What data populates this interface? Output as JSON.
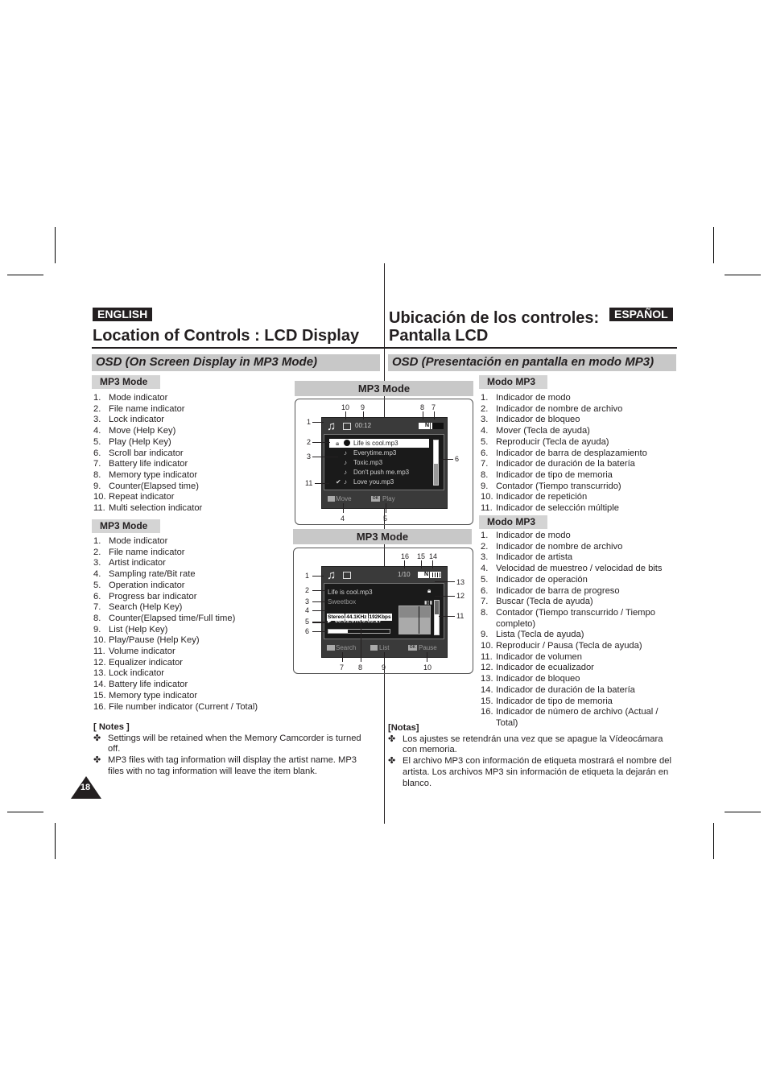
{
  "english": {
    "badge": "ENGLISH",
    "title": "Location of Controls : LCD Display",
    "section": "OSD (On Screen Display in MP3 Mode)",
    "list1": {
      "heading": "MP3 Mode",
      "items": [
        {
          "n": "1.",
          "t": "Mode indicator"
        },
        {
          "n": "2.",
          "t": "File name indicator"
        },
        {
          "n": "3.",
          "t": "Lock indicator"
        },
        {
          "n": "4.",
          "t": "Move (Help Key)"
        },
        {
          "n": "5.",
          "t": "Play (Help Key)"
        },
        {
          "n": "6.",
          "t": "Scroll bar indicator"
        },
        {
          "n": "7.",
          "t": "Battery life indicator"
        },
        {
          "n": "8.",
          "t": "Memory type indicator"
        },
        {
          "n": "9.",
          "t": "Counter(Elapsed time)"
        },
        {
          "n": "10.",
          "t": "Repeat indicator"
        },
        {
          "n": "11.",
          "t": "Multi selection indicator"
        }
      ]
    },
    "list2": {
      "heading": "MP3 Mode",
      "items": [
        {
          "n": "1.",
          "t": "Mode indicator"
        },
        {
          "n": "2.",
          "t": "File name indicator"
        },
        {
          "n": "3.",
          "t": "Artist indicator"
        },
        {
          "n": "4.",
          "t": "Sampling rate/Bit rate"
        },
        {
          "n": "5.",
          "t": "Operation indicator"
        },
        {
          "n": "6.",
          "t": "Progress bar indicator"
        },
        {
          "n": "7.",
          "t": "Search (Help Key)"
        },
        {
          "n": "8.",
          "t": "Counter(Elapsed time/Full time)"
        },
        {
          "n": "9.",
          "t": "List (Help Key)"
        },
        {
          "n": "10.",
          "t": "Play/Pause (Help Key)"
        },
        {
          "n": "11.",
          "t": "Volume indicator"
        },
        {
          "n": "12.",
          "t": "Equalizer indicator"
        },
        {
          "n": "13.",
          "t": "Lock indicator"
        },
        {
          "n": "14.",
          "t": "Battery life indicator"
        },
        {
          "n": "15.",
          "t": "Memory type indicator"
        },
        {
          "n": "16.",
          "t": "File number indicator (Current / Total)"
        }
      ]
    },
    "notes": {
      "heading": "[ Notes ]",
      "items": [
        "Settings will be retained when the Memory Camcorder is turned off.",
        "MP3 files with tag information will display the artist name. MP3 files with no tag information will leave the item blank."
      ]
    },
    "page_number": "18"
  },
  "espanol": {
    "badge": "ESPAÑOL",
    "title_line1": "Ubicación de los controles:",
    "title_line2": "Pantalla LCD",
    "section": "OSD (Presentación en pantalla en modo MP3)",
    "list1": {
      "heading": "Modo MP3",
      "items": [
        {
          "n": "1.",
          "t": "Indicador de modo"
        },
        {
          "n": "2.",
          "t": "Indicador de nombre de archivo"
        },
        {
          "n": "3.",
          "t": "Indicador de bloqueo"
        },
        {
          "n": "4.",
          "t": "Mover (Tecla de ayuda)"
        },
        {
          "n": "5.",
          "t": "Reproducir (Tecla de ayuda)"
        },
        {
          "n": "6.",
          "t": "Indicador de barra de desplazamiento"
        },
        {
          "n": "7.",
          "t": "Indicador de duración de la batería"
        },
        {
          "n": "8.",
          "t": "Indicador de tipo de memoria"
        },
        {
          "n": "9.",
          "t": "Contador (Tiempo transcurrido)"
        },
        {
          "n": "10.",
          "t": "Indicador de repetición"
        },
        {
          "n": "11.",
          "t": "Indicador de selección múltiple"
        }
      ]
    },
    "list2": {
      "heading": "Modo MP3",
      "items": [
        {
          "n": "1.",
          "t": "Indicador de modo"
        },
        {
          "n": "2.",
          "t": "Indicador de nombre de archivo"
        },
        {
          "n": "3.",
          "t": "Indicador de artista"
        },
        {
          "n": "4.",
          "t": "Velocidad de muestreo / velocidad de bits"
        },
        {
          "n": "5.",
          "t": "Indicador de operación"
        },
        {
          "n": "6.",
          "t": "Indicador de barra de progreso"
        },
        {
          "n": "7.",
          "t": "Buscar (Tecla de ayuda)"
        },
        {
          "n": "8.",
          "t": "Contador (Tiempo transcurrido / Tiempo completo)"
        },
        {
          "n": "9.",
          "t": "Lista (Tecla de ayuda)"
        },
        {
          "n": "10.",
          "t": "Reproducir / Pausa (Tecla de ayuda)"
        },
        {
          "n": "11.",
          "t": "Indicador de volumen"
        },
        {
          "n": "12.",
          "t": "Indicador de ecualizador"
        },
        {
          "n": "13.",
          "t": "Indicador de bloqueo"
        },
        {
          "n": "14.",
          "t": "Indicador de duración de la batería"
        },
        {
          "n": "15.",
          "t": "Indicador de tipo de memoria"
        },
        {
          "n": "16.",
          "t": "Indicador de número de archivo (Actual / Total)"
        }
      ]
    },
    "notes": {
      "heading": "[Notas]",
      "items": [
        "Los ajustes se retendrán una vez que se apague la Vídeocámara con memoria.",
        "El archivo MP3 con información de etiqueta mostrará el nombre del artista. Los archivos MP3 sin información de etiqueta la dejarán en blanco."
      ]
    }
  },
  "diagram1": {
    "heading": "MP3 Mode",
    "counter": "00:12",
    "memory_type": "N",
    "files": [
      "Life is cool.mp3",
      "Everytime.mp3",
      "Toxic.mp3",
      "Don't push me.mp3",
      "Love you.mp3"
    ],
    "help_move": "Move",
    "help_play": "Play",
    "ok_label": "OK",
    "callouts": {
      "c1": "1",
      "c2": "2",
      "c3": "3",
      "c4": "4",
      "c5": "5",
      "c6": "6",
      "c7": "7",
      "c8": "8",
      "c9": "9",
      "c10": "10",
      "c11": "11"
    }
  },
  "diagram2": {
    "heading": "MP3 Mode",
    "file_number": "1/10",
    "memory_type": "N",
    "filename": "Life is cool.mp3",
    "artist": "Sweetbox",
    "audio_mode": "Stereo",
    "sampling_rate": "44.1KHz",
    "bit_rate": "192Kbps",
    "counter": "00:01:07/00:03:27",
    "progress_fraction": 0.32,
    "volume_fraction": 0.6,
    "help_search": "Search",
    "help_list": "List",
    "help_pause": "Pause",
    "ok_label": "OK",
    "callouts": {
      "c1": "1",
      "c2": "2",
      "c3": "3",
      "c4": "4",
      "c5": "5",
      "c6": "6",
      "c7": "7",
      "c8": "8",
      "c9": "9",
      "c10": "10",
      "c11": "11",
      "c12": "12",
      "c13": "13",
      "c14": "14",
      "c15": "15",
      "c16": "16"
    }
  }
}
